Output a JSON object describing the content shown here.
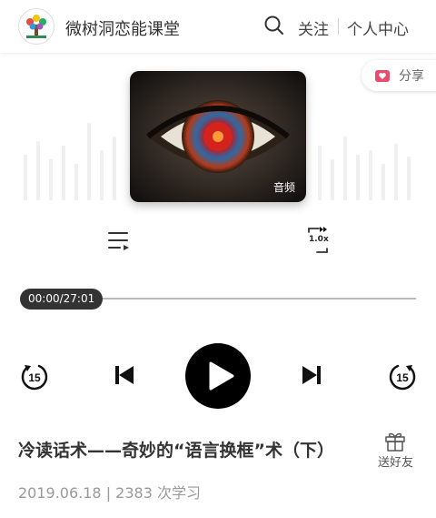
{
  "header": {
    "shop_title": "微树洞恋能课堂",
    "follow_label": "关注",
    "center_label": "个人中心"
  },
  "share": {
    "label": "分享"
  },
  "cover": {
    "badge": "音频"
  },
  "player": {
    "speed": "1.0x",
    "time_display": "00:00/27:01",
    "progress": 0,
    "rewind_seconds": "15",
    "forward_seconds": "15"
  },
  "course": {
    "title": "冷读话术——奇妙的“语言换框”术（下）",
    "gift_label": "送好友",
    "meta": "2019.06.18 | 2383 次学习"
  },
  "colors": {
    "accent": "#e84d6f",
    "play_button": "#000000",
    "time_pill": "#333333"
  }
}
